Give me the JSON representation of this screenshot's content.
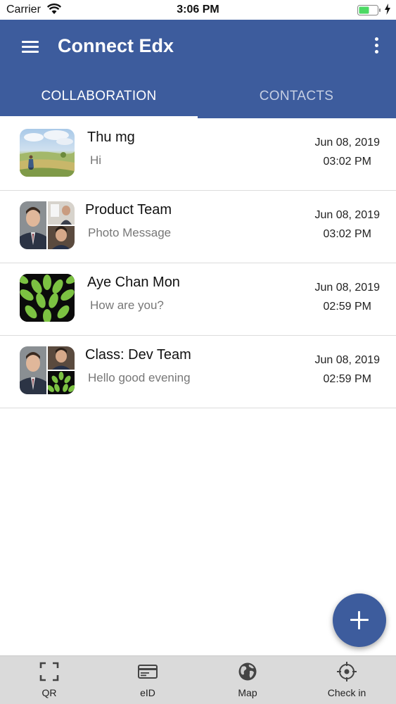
{
  "status_bar": {
    "carrier": "Carrier",
    "time": "3:06 PM"
  },
  "app_bar": {
    "title": "Connect Edx"
  },
  "tabs": [
    {
      "label": "COLLABORATION",
      "selected": true
    },
    {
      "label": "CONTACTS",
      "selected": false
    }
  ],
  "conversations": [
    {
      "name": "Thu mg",
      "preview": "Hi",
      "date": "Jun 08, 2019",
      "time": "03:02 PM",
      "avatar": "landscape-photo"
    },
    {
      "name": "Product Team",
      "preview": "Photo Message",
      "date": "Jun 08, 2019",
      "time": "03:02 PM",
      "avatar": "group-photo-collage"
    },
    {
      "name": "Aye Chan Mon",
      "preview": "How are you?",
      "date": "Jun 08, 2019",
      "time": "02:59 PM",
      "avatar": "leaf-pattern"
    },
    {
      "name": "Class: Dev Team",
      "preview": "Hello good evening",
      "date": "Jun 08, 2019",
      "time": "02:59 PM",
      "avatar": "group-photo-collage"
    }
  ],
  "bottom_nav": [
    {
      "label": "QR",
      "icon": "qr-scan-icon"
    },
    {
      "label": "eID",
      "icon": "id-card-icon"
    },
    {
      "label": "Map",
      "icon": "globe-icon"
    },
    {
      "label": "Check in",
      "icon": "crosshair-icon"
    }
  ],
  "colors": {
    "primary": "#3d5c9d",
    "tab_inactive": "#c6cfe3",
    "battery_green": "#4cd964",
    "bottom_nav_bg": "#dadada"
  }
}
